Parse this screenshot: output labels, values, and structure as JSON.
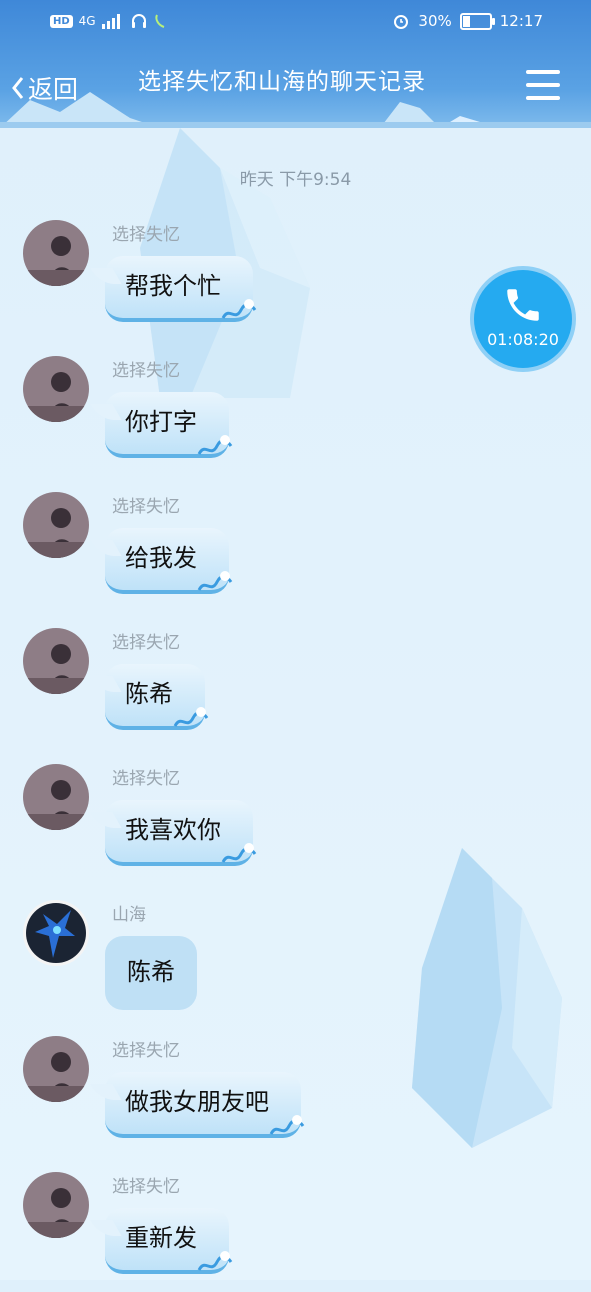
{
  "status_bar": {
    "hd": "HD",
    "network": "4G",
    "battery": "30%",
    "battery_level": 0.3,
    "time": "12:17"
  },
  "header": {
    "back_label": "返回",
    "title": "选择失忆和山海的聊天记录",
    "menu_icon": "menu-icon"
  },
  "chat": {
    "timestamp": "昨天 下午9:54",
    "messages": [
      {
        "sender": "选择失忆",
        "text": "帮我个忙"
      },
      {
        "sender": "选择失忆",
        "text": "你打字"
      },
      {
        "sender": "选择失忆",
        "text": "给我发"
      },
      {
        "sender": "选择失忆",
        "text": "陈希"
      },
      {
        "sender": "选择失忆",
        "text": "我喜欢你"
      },
      {
        "sender": "山海",
        "text": "陈希"
      },
      {
        "sender": "选择失忆",
        "text": "做我女朋友吧"
      },
      {
        "sender": "选择失忆",
        "text": "重新发"
      }
    ]
  },
  "call": {
    "icon": "phone-icon",
    "duration": "01:08:20",
    "color": "#25aaf0"
  },
  "colors": {
    "header_blue": "#3f88d8",
    "bubble_border": "#5fb2e6",
    "background": "#e2f2fc"
  }
}
